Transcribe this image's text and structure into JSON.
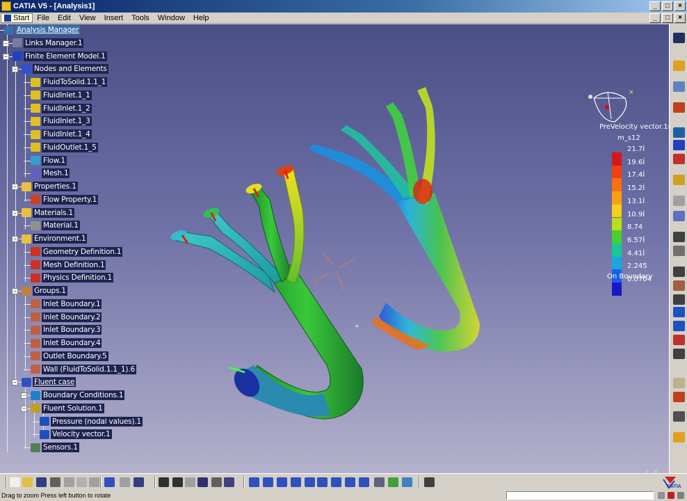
{
  "window": {
    "title": "CATIA V5 - [Analysis1]",
    "controls": [
      "_",
      "□",
      "×"
    ]
  },
  "menu": {
    "items": [
      "Start",
      "File",
      "Edit",
      "View",
      "Insert",
      "Tools",
      "Window",
      "Help"
    ]
  },
  "tree": {
    "nodes": [
      {
        "label": "Analysis Manager",
        "icon": "analysis-manager-icon",
        "color": "#3a6ea5"
      },
      {
        "label": "Links Manager.1",
        "icon": "links-manager-icon",
        "color": "#7a7aa0"
      },
      {
        "label": "Finite Element Model.1",
        "icon": "fem-model-icon",
        "color": "#2040c0"
      },
      {
        "label": "Nodes and Elements",
        "icon": "nodes-elements-icon",
        "color": "#3050d0"
      },
      {
        "label": "FluidToSolid.1.1_1",
        "icon": "mesh-part-icon",
        "color": "#e0c020"
      },
      {
        "label": "FluidInlet.1_1",
        "icon": "mesh-part-icon",
        "color": "#e0c020"
      },
      {
        "label": "FluidInlet.1_2",
        "icon": "mesh-part-icon",
        "color": "#e0c020"
      },
      {
        "label": "FluidInlet.1_3",
        "icon": "mesh-part-icon",
        "color": "#e0c020"
      },
      {
        "label": "FluidInlet.1_4",
        "icon": "mesh-part-icon",
        "color": "#e0c020"
      },
      {
        "label": "FluidOutlet.1_5",
        "icon": "mesh-part-icon",
        "color": "#e0c020"
      },
      {
        "label": "Flow.1",
        "icon": "flow-icon",
        "color": "#30a0d0"
      },
      {
        "label": "Mesh.1",
        "icon": "mesh-icon",
        "color": "#6060c0"
      },
      {
        "label": "Properties.1",
        "icon": "folder-icon",
        "color": "#e8c040"
      },
      {
        "label": "Flow Property.1",
        "icon": "flow-property-icon",
        "color": "#d04020"
      },
      {
        "label": "Materials.1",
        "icon": "folder-icon",
        "color": "#e8c040"
      },
      {
        "label": "Material.1",
        "icon": "material-icon",
        "color": "#909090"
      },
      {
        "label": "Environment.1",
        "icon": "folder-icon",
        "color": "#e8c040"
      },
      {
        "label": "Geometry Definition.1",
        "icon": "triangle-red-icon",
        "color": "#d03020"
      },
      {
        "label": "Mesh Definition.1",
        "icon": "triangle-red-icon",
        "color": "#d03020"
      },
      {
        "label": "Physics Definition.1",
        "icon": "triangle-red-icon",
        "color": "#d03020"
      },
      {
        "label": "Groups.1",
        "icon": "groups-icon",
        "color": "#c08040"
      },
      {
        "label": "Inlet Boundary.1",
        "icon": "boundary-icon",
        "color": "#c06040"
      },
      {
        "label": "Inlet Boundary.2",
        "icon": "boundary-icon",
        "color": "#c06040"
      },
      {
        "label": "Inlet Boundary.3",
        "icon": "boundary-icon",
        "color": "#c06040"
      },
      {
        "label": "Inlet Boundary.4",
        "icon": "boundary-icon",
        "color": "#c06040"
      },
      {
        "label": "Outlet Boundary.5",
        "icon": "boundary-icon",
        "color": "#c06040"
      },
      {
        "label": "Wall (FluidToSolid.1.1_1).6",
        "icon": "boundary-icon",
        "color": "#c06040"
      },
      {
        "label": "Fluent case",
        "icon": "fluent-case-icon",
        "color": "#3050c0"
      },
      {
        "label": "Boundary Conditions.1",
        "icon": "boundary-conditions-icon",
        "color": "#2080d0"
      },
      {
        "label": "Fluent Solution.1",
        "icon": "fluent-solution-icon",
        "color": "#c0a020"
      },
      {
        "label": "Pressure (nodal values).1",
        "icon": "pressure-image-icon",
        "color": "#2050c0"
      },
      {
        "label": "Velocity vector.1",
        "icon": "velocity-image-icon",
        "color": "#2050c0"
      },
      {
        "label": "Sensors.1",
        "icon": "sensors-icon",
        "color": "#508050"
      }
    ]
  },
  "legend": {
    "title": "PreVelocity vector.1ıes).1",
    "unit": "m_s12",
    "values": [
      "21.7İ",
      "19.6İ",
      "17.4İ",
      "15.2İ",
      "13.1İ",
      "10.9İ",
      "8.74",
      "6.57İ",
      "4.41İ",
      "2.245",
      "0.0704"
    ],
    "colors": [
      "#d81818",
      "#f04010",
      "#f87010",
      "#f8a010",
      "#f8d018",
      "#b8e018",
      "#48d030",
      "#18c890",
      "#18a8e0",
      "#1860e8",
      "#1818c8"
    ],
    "caption": "On Boundary"
  },
  "status": {
    "message": "Drag to zoom  Press left button to rotate"
  },
  "brand": {
    "logo_text": "CATIA"
  }
}
